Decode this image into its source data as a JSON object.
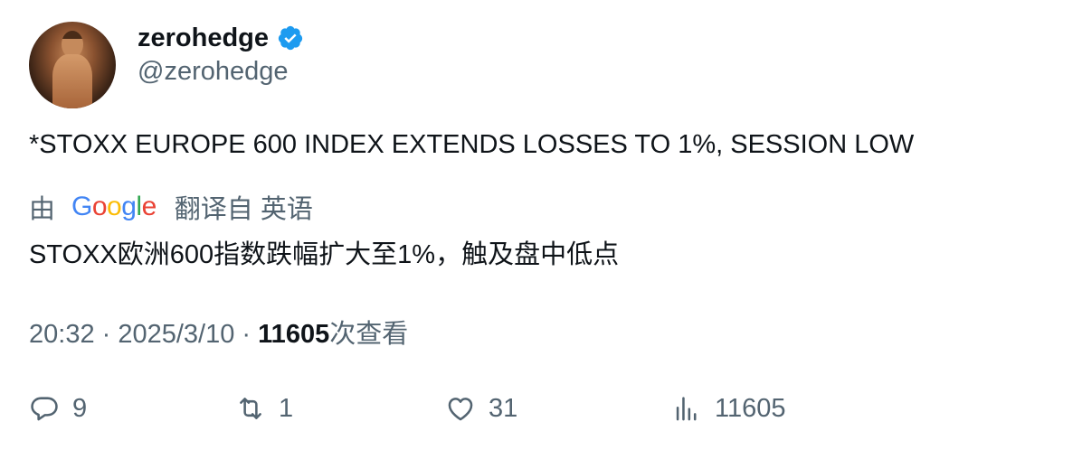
{
  "author": {
    "display_name": "zerohedge",
    "handle": "@zerohedge",
    "verified_icon": "verified-badge-icon",
    "avatar_icon": "avatar-photo"
  },
  "tweet": {
    "text": "*STOXX EUROPE 600 INDEX EXTENDS LOSSES TO 1%, SESSION LOW"
  },
  "translation": {
    "prefix": "由",
    "provider": "Google",
    "suffix": "翻译自 英语",
    "text": "STOXX欧洲600指数跌幅扩大至1%，触及盘中低点"
  },
  "meta": {
    "time": "20:32",
    "sep1": " · ",
    "date": "2025/3/10",
    "sep2": " · ",
    "views_count": "11605",
    "views_label": "次查看"
  },
  "actions": {
    "reply_count": "9",
    "retweet_count": "1",
    "like_count": "31",
    "views_count": "11605"
  },
  "colors": {
    "text_primary": "#0f1419",
    "text_secondary": "#536471",
    "verified": "#1d9bf0",
    "google_blue": "#4285F4",
    "google_red": "#EA4335",
    "google_yellow": "#FBBC05",
    "google_green": "#34A853"
  }
}
